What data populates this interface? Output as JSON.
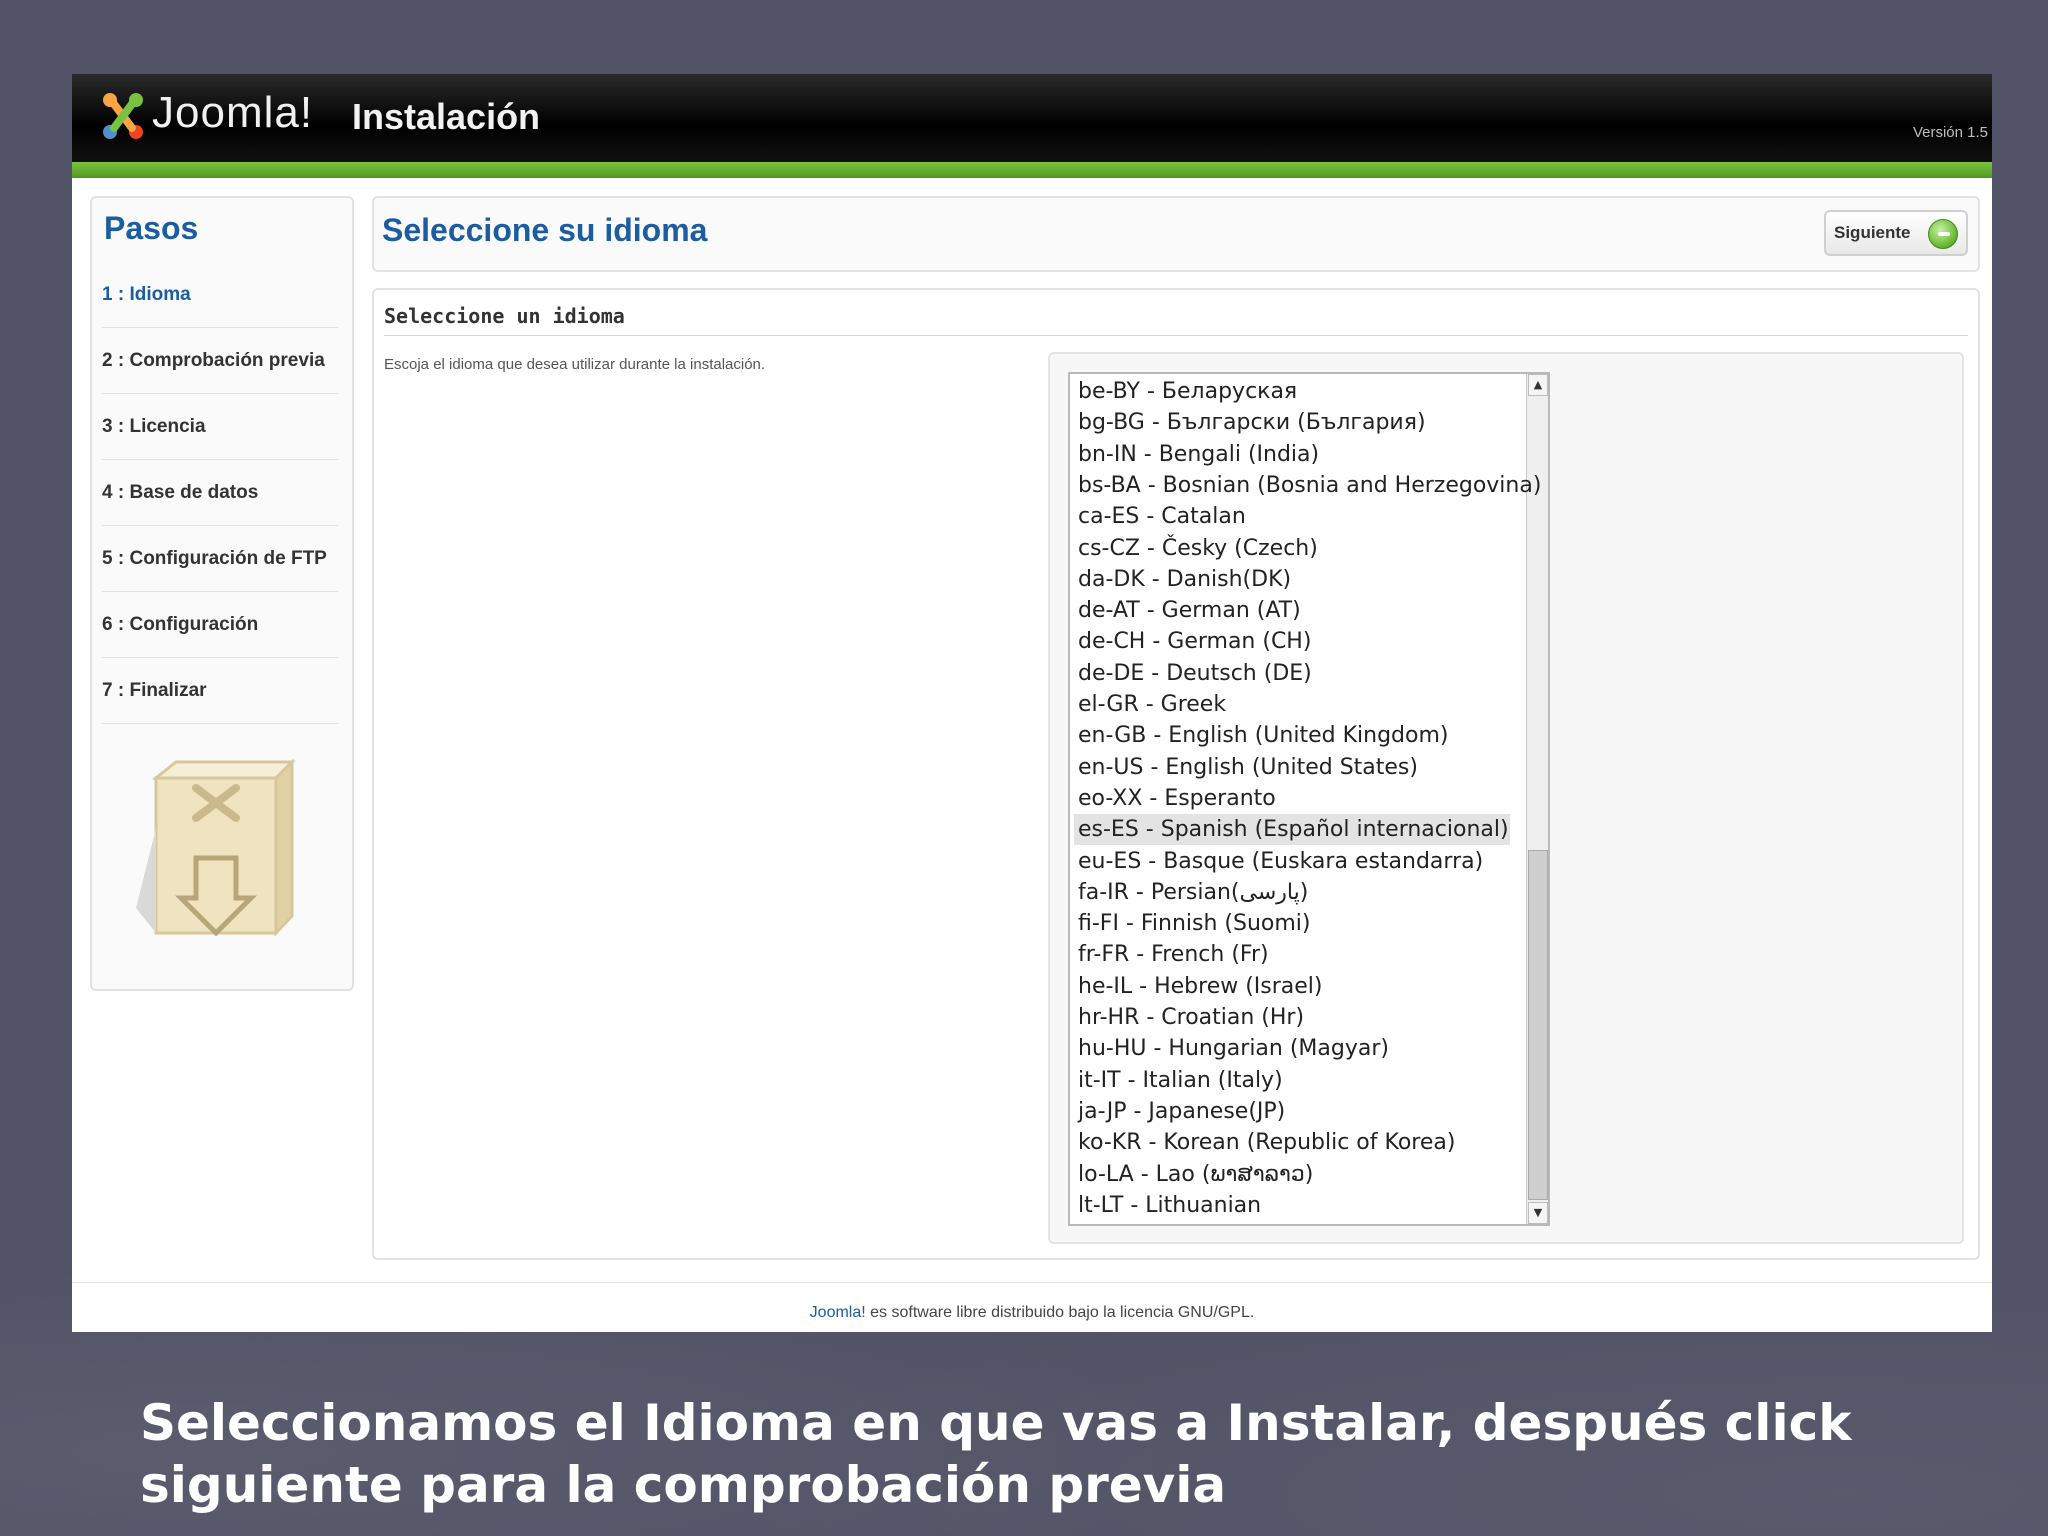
{
  "header": {
    "logo_text": "Joomla!",
    "title": "Instalación",
    "version": "Versión 1.5"
  },
  "sidebar": {
    "title": "Pasos",
    "steps": [
      {
        "num": "1",
        "label": "Idioma"
      },
      {
        "num": "2",
        "label": "Comprobación previa"
      },
      {
        "num": "3",
        "label": "Licencia"
      },
      {
        "num": "4",
        "label": "Base de datos"
      },
      {
        "num": "5",
        "label": "Configuración de FTP"
      },
      {
        "num": "6",
        "label": "Configuración"
      },
      {
        "num": "7",
        "label": "Finalizar"
      }
    ]
  },
  "main": {
    "title": "Seleccione su idioma",
    "next_label": "Siguiente",
    "section_title": "Seleccione un idioma",
    "hint": "Escoja el idioma que desea utilizar durante la instalación.",
    "selected_index": 14,
    "languages": [
      "be-BY - Беларуская",
      "bg-BG - Български (България)",
      "bn-IN - Bengali (India)",
      "bs-BA - Bosnian (Bosnia and Herzegovina)",
      "ca-ES - Catalan",
      "cs-CZ - Česky (Czech)",
      "da-DK - Danish(DK)",
      "de-AT - German (AT)",
      "de-CH - German (CH)",
      "de-DE - Deutsch (DE)",
      "el-GR - Greek",
      "en-GB - English (United Kingdom)",
      "en-US - English (United States)",
      "eo-XX - Esperanto",
      "es-ES - Spanish (Español internacional)",
      "eu-ES - Basque (Euskara estandarra)",
      "fa-IR - Persian(پارسی)",
      "fi-FI - Finnish (Suomi)",
      "fr-FR - French (Fr)",
      "he-IL - Hebrew (Israel)",
      "hr-HR - Croatian (Hr)",
      "hu-HU - Hungarian (Magyar)",
      "it-IT - Italian (Italy)",
      "ja-JP - Japanese(JP)",
      "ko-KR - Korean (Republic of Korea)",
      "lo-LA - Lao (ພາສາລາວ)",
      "lt-LT - Lithuanian"
    ]
  },
  "footer": {
    "link": "Joomla!",
    "text": " es software libre distribuido bajo la licencia GNU/GPL."
  },
  "caption": {
    "line1": "Seleccionamos el Idioma en que vas a Instalar, después click",
    "line2": "siguiente para la comprobación previa"
  }
}
